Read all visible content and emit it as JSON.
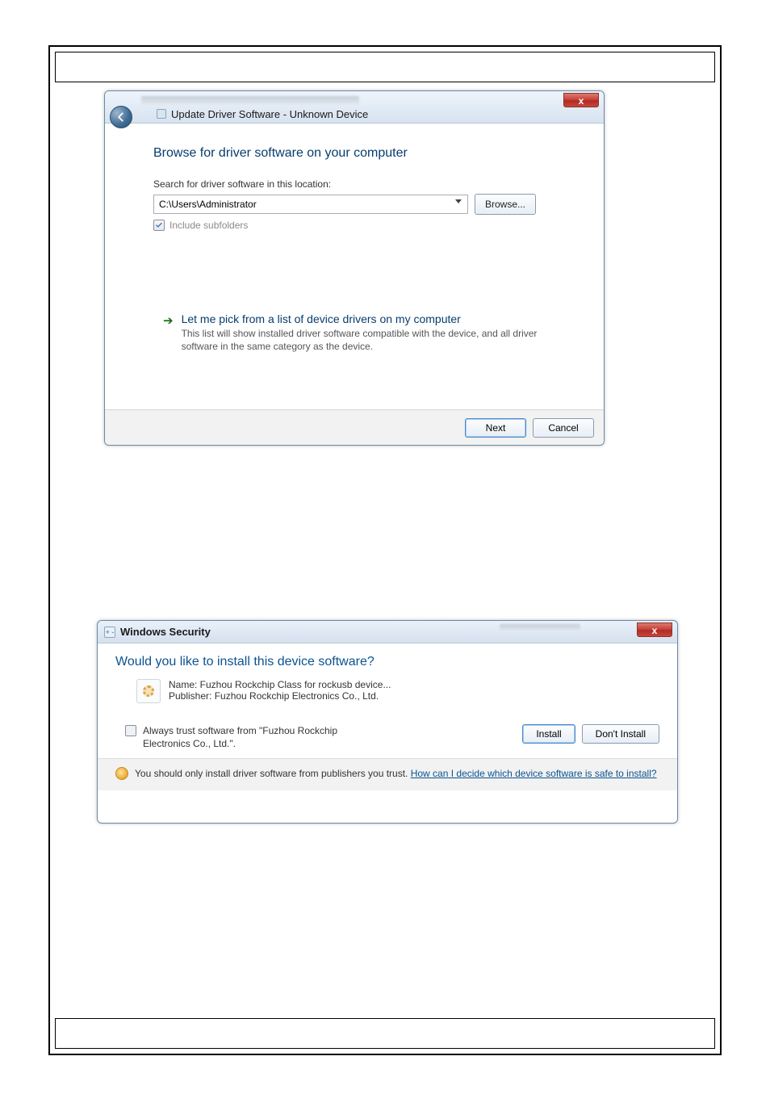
{
  "dialog1": {
    "breadcrumb": "Update Driver Software - Unknown Device",
    "close_glyph": "x",
    "heading": "Browse for driver software on your computer",
    "search_label": "Search for driver software in this location:",
    "path_value": "C:\\Users\\Administrator",
    "browse_label": "Browse...",
    "include_subfolders_label": "Include subfolders",
    "option": {
      "title": "Let me pick from a list of device drivers on my computer",
      "desc": "This list will show installed driver software compatible with the device, and all driver software in the same category as the device."
    },
    "footer": {
      "next": "Next",
      "cancel": "Cancel"
    }
  },
  "dialog2": {
    "sys_glyph": "+ -",
    "title": "Windows Security",
    "close_glyph": "x",
    "heading": "Would you like to install this device software?",
    "device_name": "Name: Fuzhou Rockchip Class for rockusb device...",
    "device_publisher": "Publisher: Fuzhou Rockchip Electronics Co., Ltd.",
    "trust_label": "Always trust software from \"Fuzhou Rockchip Electronics Co., Ltd.\".",
    "install": "Install",
    "dont_install": "Don't Install",
    "warning_prefix": "You should only install driver software from publishers you trust.  ",
    "warning_link": "How can I decide which device software is safe to install?"
  }
}
